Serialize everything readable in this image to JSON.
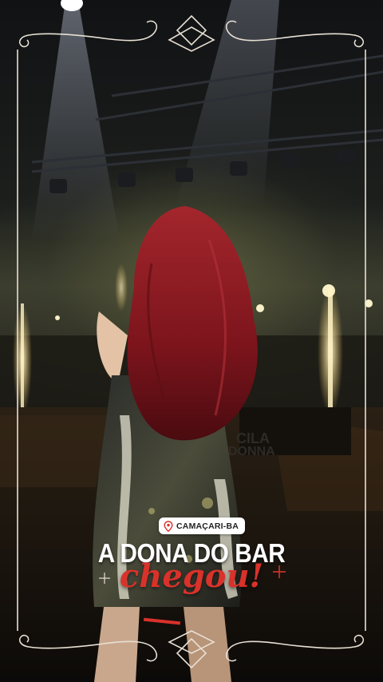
{
  "location": {
    "icon": "map-pin-icon",
    "label": "CAMAÇARI-BA"
  },
  "headline": {
    "line1": "A DONA DO BAR",
    "line2": "chegou!"
  },
  "stage_banner_text": "CILA\nDONNA",
  "colors": {
    "frame": "#e8e0d4",
    "accent": "#d9322a",
    "hair": "#8e1c22"
  }
}
